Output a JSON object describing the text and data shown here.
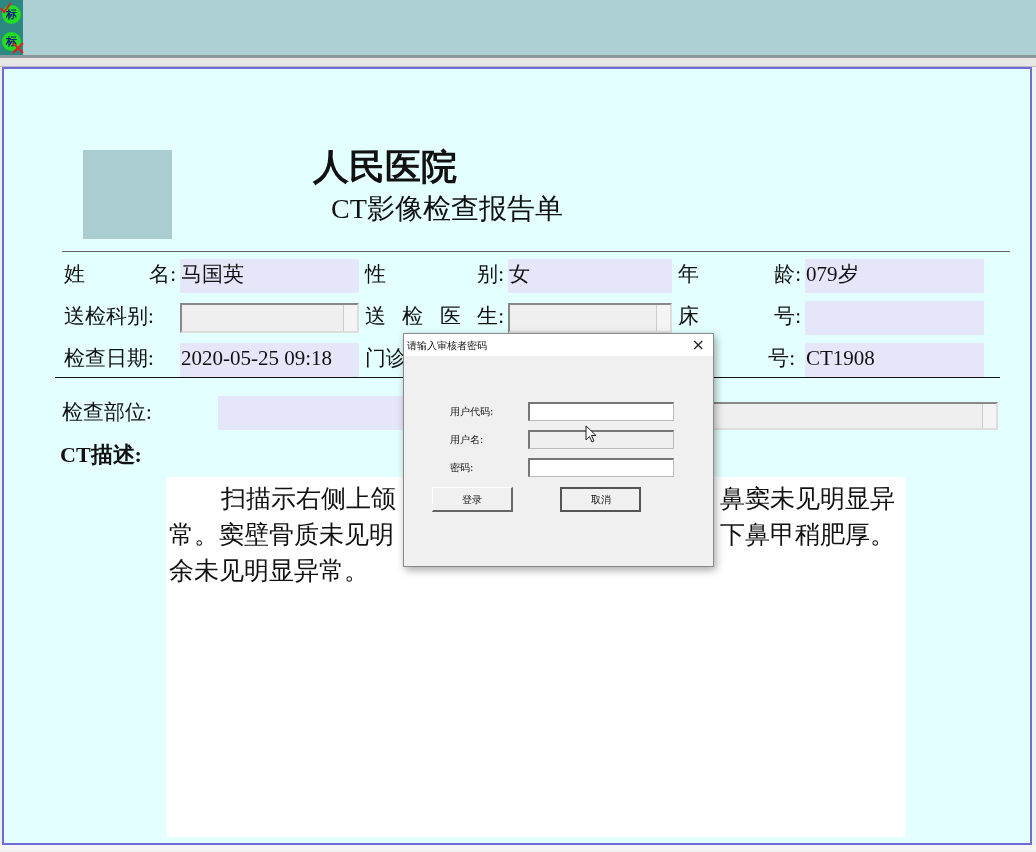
{
  "toolbar": {
    "buttons": [
      {
        "label": "标",
        "kind": "approve"
      },
      {
        "label": "标",
        "kind": "reject"
      }
    ]
  },
  "report": {
    "hospital": "人民医院",
    "title": "CT影像检查报告单",
    "rows": [
      [
        {
          "label": [
            "姓",
            "名:"
          ],
          "kind": "text",
          "value": "马国英"
        },
        {
          "label": [
            "性",
            "别:"
          ],
          "kind": "text",
          "value": "女"
        },
        {
          "label": [
            "年",
            "龄:"
          ],
          "kind": "text",
          "value": "079岁"
        }
      ],
      [
        {
          "label": [
            "送检科别:"
          ],
          "kind": "combo"
        },
        {
          "label": [
            "送",
            "检",
            "医",
            "生:"
          ],
          "kind": "combo"
        },
        {
          "label": [
            "床",
            "号:"
          ],
          "kind": "text"
        }
      ],
      [
        {
          "label": [
            "检查日期:"
          ],
          "kind": "text",
          "value": "2020-05-25 09:18"
        },
        {
          "label": [
            "门诊"
          ],
          "kind": "hidden"
        },
        {
          "label": [
            "号:"
          ],
          "kind": "text",
          "value": "CT1908",
          "partial_label": true
        }
      ]
    ],
    "exam_site": {
      "label": "检查部位:"
    },
    "description": {
      "label": "CT描述:",
      "lines": [
        [
          "扫描示右侧上颌",
          "鼻窦未见明显异"
        ],
        [
          "常。窦壁骨质未见明",
          "下鼻甲稍肥厚。"
        ],
        [
          "余未见明显异常。"
        ]
      ]
    }
  },
  "dialog": {
    "title": "请输入审核者密码",
    "close": "×",
    "fields": [
      {
        "label": "用户代码:",
        "disabled": false
      },
      {
        "label": "用户名:",
        "disabled": true
      },
      {
        "label": "密码:",
        "disabled": false
      }
    ],
    "buttons": [
      {
        "label": "登录",
        "default": false
      },
      {
        "label": "取消",
        "default": true
      }
    ]
  }
}
